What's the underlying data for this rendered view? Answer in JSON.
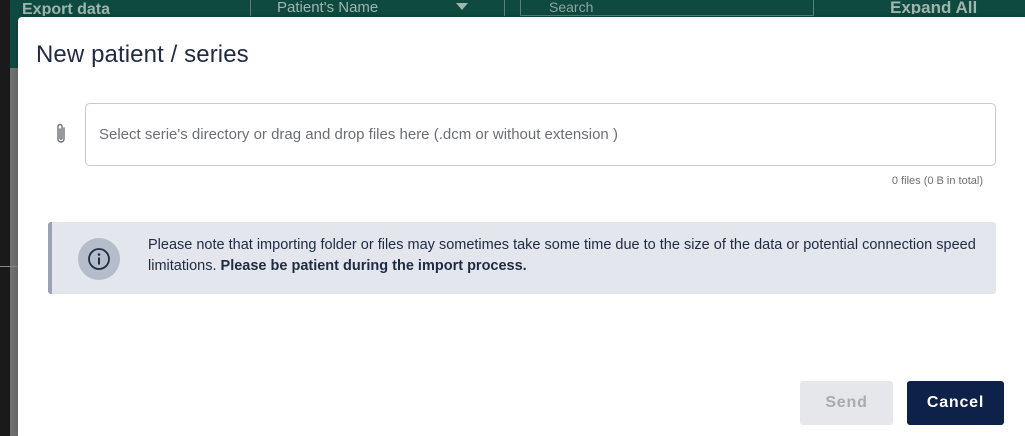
{
  "background": {
    "export_label": "Export data",
    "select_label": "Patient's Name",
    "search_placeholder": "Search",
    "expand_label": "Expand All"
  },
  "modal": {
    "title": "New patient / series",
    "file_input": {
      "placeholder": "Select serie's directory or drag and drop files here (.dcm or without extension )",
      "icon": "paperclip-icon"
    },
    "file_count": "0 files (0 B in total)",
    "notice": {
      "icon": "info-icon",
      "text": "Please note that importing folder or files may sometimes take some time due to the size of the data or potential connection speed limitations.",
      "bold_text": "Please be patient during the import process."
    },
    "buttons": {
      "send": "Send",
      "cancel": "Cancel"
    }
  },
  "colors": {
    "primary": "#0d2149",
    "notice_bg": "#e3e6ec",
    "toolbar_bg": "#0e4a3f"
  }
}
